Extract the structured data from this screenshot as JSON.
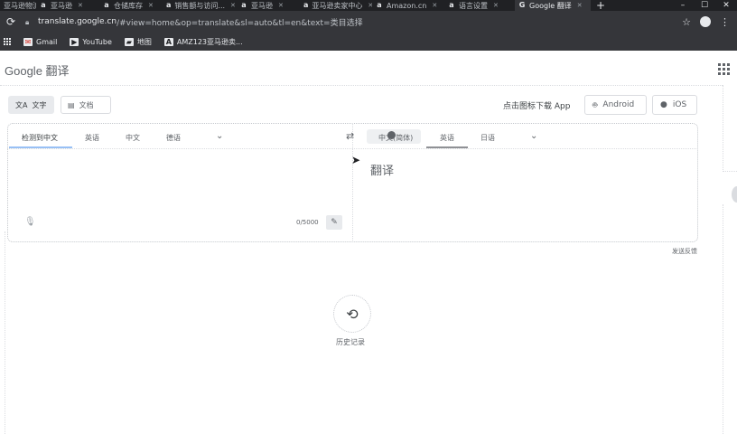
{
  "browser": {
    "tabs": [
      {
        "label": "亚马逊物流...",
        "icon": "a"
      },
      {
        "label": "亚马逊",
        "icon": "a"
      },
      {
        "label": "仓储库存",
        "icon": "a"
      },
      {
        "label": "销售额与访问...",
        "icon": "a"
      },
      {
        "label": "亚马逊",
        "icon": "a"
      },
      {
        "label": "亚马逊卖家中心",
        "icon": "a"
      },
      {
        "label": "Amazon.cn",
        "icon": "a"
      },
      {
        "label": "语言设置",
        "icon": "a"
      },
      {
        "label": "Google 翻译",
        "icon": "G",
        "active": true
      }
    ],
    "new_tab_label": "+",
    "window_controls": {
      "minimize": "–",
      "maximize": "☐",
      "close": "✕"
    },
    "url_host": "translate.google.cn",
    "url_path": "/#view=home&op=translate&sl=auto&tl=en&text=类目选择",
    "bookmarks": [
      {
        "label": "Gmail",
        "icon": "gmail-icon"
      },
      {
        "label": "YouTube",
        "icon": "youtube-icon"
      },
      {
        "label": "地图",
        "icon": "maps-icon"
      },
      {
        "label": "AMZ123亚马逊卖...",
        "icon": "amz123-icon"
      }
    ]
  },
  "page": {
    "logo": "Google 翻译",
    "mode_text": "文字",
    "mode_docs": "文档",
    "download_text": "点击图标下载 App",
    "android_label": "Android",
    "ios_label": "iOS",
    "source_langs": [
      "检测到中文",
      "英语",
      "中文",
      "德语"
    ],
    "target_langs": [
      "中文(简体)",
      "英语",
      "日语"
    ],
    "output_text": "翻译",
    "char_count": "0/5000",
    "feedback": "发送反馈",
    "history_label": "历史记录"
  }
}
